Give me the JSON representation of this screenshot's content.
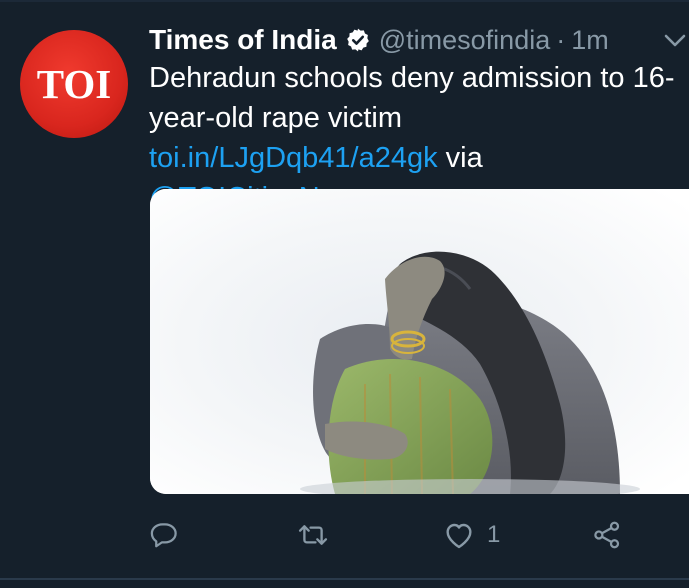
{
  "tweet": {
    "avatar_text": "TOI",
    "display_name": "Times of India",
    "handle": "@timesofindia",
    "separator": "·",
    "time": "1m",
    "text_plain_1": "Dehradun schools deny admission to 16-year-old rape victim ",
    "link_1": "toi.in/LJgDqb41/a24gk",
    "text_plain_2": " via ",
    "mention": "@TOICitiesNews",
    "like_count": "1"
  },
  "icons": {
    "verified": "verified-badge-icon",
    "menu": "chevron-down-icon",
    "reply": "reply-icon",
    "retweet": "retweet-icon",
    "like": "heart-icon",
    "share": "share-icon"
  },
  "colors": {
    "background": "#15202b",
    "text": "#ffffff",
    "muted": "#8899a6",
    "link": "#1da1f2",
    "avatar": "#d9261e"
  }
}
